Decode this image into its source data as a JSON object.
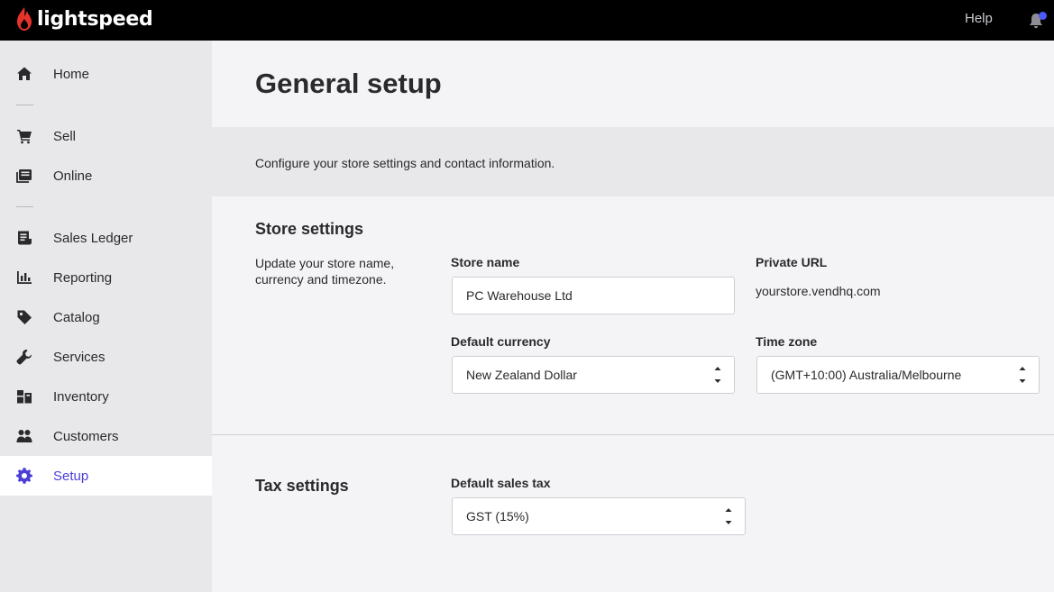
{
  "topbar": {
    "brand": "lightspeed",
    "help": "Help"
  },
  "sidebar": {
    "items": [
      {
        "label": "Home",
        "icon": "home-icon"
      },
      {
        "label": "Sell",
        "icon": "cart-icon"
      },
      {
        "label": "Online",
        "icon": "online-icon"
      },
      {
        "label": "Sales Ledger",
        "icon": "ledger-icon"
      },
      {
        "label": "Reporting",
        "icon": "chart-icon"
      },
      {
        "label": "Catalog",
        "icon": "tag-icon"
      },
      {
        "label": "Services",
        "icon": "wrench-icon"
      },
      {
        "label": "Inventory",
        "icon": "boxes-icon"
      },
      {
        "label": "Customers",
        "icon": "users-icon"
      },
      {
        "label": "Setup",
        "icon": "gear-icon"
      }
    ],
    "active": "Setup"
  },
  "page": {
    "title": "General setup",
    "description": "Configure your store settings and contact information."
  },
  "store_settings": {
    "title": "Store settings",
    "description": "Update your store name, currency and timezone.",
    "store_name_label": "Store name",
    "store_name_value": "PC Warehouse Ltd",
    "private_url_label": "Private URL",
    "private_url_value": "yourstore.vendhq.com",
    "currency_label": "Default currency",
    "currency_value": "New Zealand Dollar",
    "timezone_label": "Time zone",
    "timezone_value": "(GMT+10:00) Australia/Melbourne"
  },
  "tax_settings": {
    "title": "Tax settings",
    "sales_tax_label": "Default sales tax",
    "sales_tax_value": "GST (15%)"
  },
  "colors": {
    "accent": "#4c3fd6",
    "brand_red": "#e8322c",
    "notification": "#4c5bf5"
  }
}
